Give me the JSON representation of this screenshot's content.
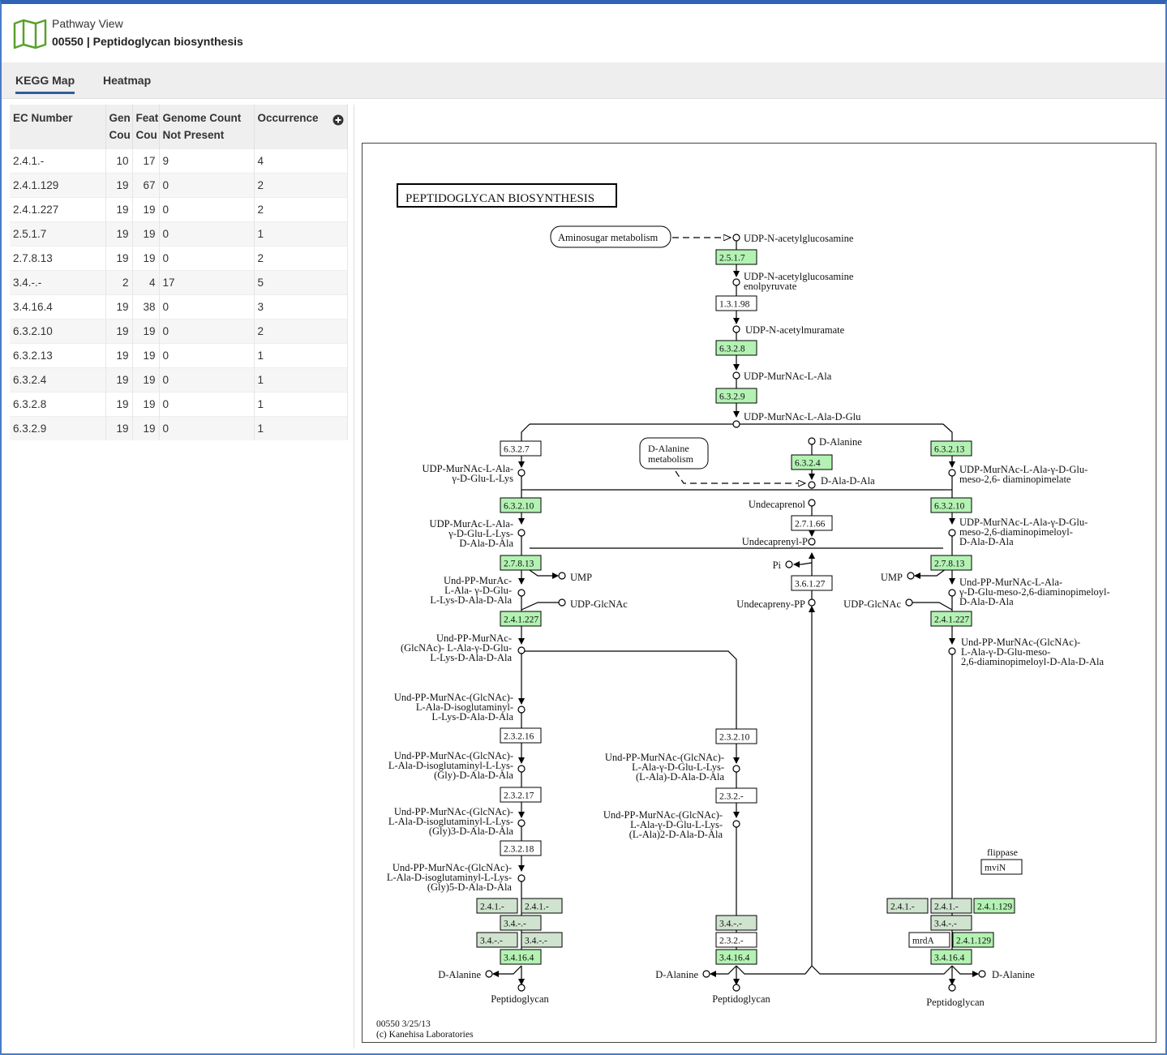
{
  "header": {
    "label": "Pathway View",
    "title": "00550 | Peptidoglycan biosynthesis"
  },
  "tabs": [
    {
      "label": "KEGG Map",
      "active": true
    },
    {
      "label": "Heatmap",
      "active": false
    }
  ],
  "table": {
    "columns": [
      "EC Number",
      "Genome Count",
      "Feature Count",
      "Genome Count Not Present",
      "Occurrence"
    ],
    "column_display": [
      "EC Number",
      "Gen Cou",
      "Feat Cou",
      "Genome Count Not Present",
      "Occurrence"
    ],
    "rows": [
      [
        "2.4.1.-",
        "10",
        "17",
        "9",
        "4"
      ],
      [
        "2.4.1.129",
        "19",
        "67",
        "0",
        "2"
      ],
      [
        "2.4.1.227",
        "19",
        "19",
        "0",
        "2"
      ],
      [
        "2.5.1.7",
        "19",
        "19",
        "0",
        "1"
      ],
      [
        "2.7.8.13",
        "19",
        "19",
        "0",
        "2"
      ],
      [
        "3.4.-.-",
        "2",
        "4",
        "17",
        "5"
      ],
      [
        "3.4.16.4",
        "19",
        "38",
        "0",
        "3"
      ],
      [
        "6.3.2.10",
        "19",
        "19",
        "0",
        "2"
      ],
      [
        "6.3.2.13",
        "19",
        "19",
        "0",
        "1"
      ],
      [
        "6.3.2.4",
        "19",
        "19",
        "0",
        "1"
      ],
      [
        "6.3.2.8",
        "19",
        "19",
        "0",
        "1"
      ],
      [
        "6.3.2.9",
        "19",
        "19",
        "0",
        "1"
      ]
    ]
  },
  "map": {
    "title": "PEPTIDOGLYCAN BIOSYNTHESIS",
    "footer_id": "00550 3/25/13",
    "footer_copyright": "(c) Kanehisa Laboratories",
    "colors": {
      "present": "#b3f2b3",
      "partial": "#cfe3cf",
      "absent": "#ffffff"
    },
    "links": {
      "aminosugar": "Aminosugar metabolism",
      "dalanine_meta": [
        "D-Alanine",
        "metabolism"
      ]
    },
    "compounds": {
      "c1": "UDP-N-acetylglucosamine",
      "c2a": "UDP-N-acetylglucosamine",
      "c2b": "enolpyruvate",
      "c3": "UDP-N-acetylmuramate",
      "c4": "UDP-MurNAc-L-Ala",
      "c5": "UDP-MurNAc-L-Ala-D-Glu",
      "dala": "D-Alanine",
      "dalada": "D-Ala-D-Ala",
      "left1": [
        "UDP-MurNAc-L-Ala-",
        "γ-D-Glu-L-Lys"
      ],
      "left2": [
        "UDP-MurAc-L-Ala-",
        "γ-D-Glu-L-Lys-",
        "D-Ala-D-Ala"
      ],
      "left3": [
        "Und-PP-MurAc-",
        "L-Ala- γ-D-Glu-",
        "L-Lys-D-Ala-D-Ala"
      ],
      "left4": [
        "Und-PP-MurNAc-",
        "(GlcNAc)- L-Ala-γ-D-Glu-",
        "L-Lys-D-Ala-D-Ala"
      ],
      "left5": [
        "Und-PP-MurNAc-(GlcNAc)-",
        "L-Ala-D-isoglutaminyl-",
        "L-Lys-D-Ala-D-Ala"
      ],
      "left6": [
        "Und-PP-MurNAc-(GlcNAc)-",
        "L-Ala-D-isoglutaminyl-L-Lys-",
        "(Gly)-D-Ala-D-Ala"
      ],
      "left7": [
        "Und-PP-MurNAc-(GlcNAc)-",
        "L-Ala-D-isoglutaminyl-L-Lys-",
        "(Gly)3-D-Ala-D-Ala"
      ],
      "left8": [
        "Und-PP-MurNAc-(GlcNAc)-",
        "L-Ala-D-isoglutaminyl-L-Lys-",
        "(Gly)5-D-Ala-D-Ala"
      ],
      "mid1": [
        "Und-PP-MurNAc-(GlcNAc)-",
        "L-Ala-γ-D-Glu-L-Lys-",
        "(L-Ala)-D-Ala-D-Ala"
      ],
      "mid2": [
        "Und-PP-MurNAc-(GlcNAc)-",
        "L-Ala-γ-D-Glu-L-Lys-",
        "(L-Ala)2-D-Ala-D-Ala"
      ],
      "right1": [
        "UDP-MurNAc-L-Ala-γ-D-Glu-",
        "meso-2,6- diaminopimelate"
      ],
      "right2": [
        "UDP-MurNAc-L-Ala-γ-D-Glu-",
        "meso-2,6-diaminopimeloyl-",
        "D-Ala-D-Ala"
      ],
      "right3": [
        "Und-PP-MurNAc-L-Ala-",
        "γ-D-Glu-meso-2,6-diaminopimeloyl-",
        "D-Ala-D-Ala"
      ],
      "right4": [
        "Und-PP-MurNAc-(GlcNAc)-",
        "L-Ala-γ-D-Glu-meso-",
        "2,6-diaminopimeloyl-D-Ala-D-Ala"
      ],
      "undecaprenol": "Undecaprenol",
      "undecaprenylp": "Undecaprenyl-P",
      "undecaprenypp": "Undecapreny-PP",
      "pi": "Pi",
      "ump": "UMP",
      "udpglcnac": "UDP-GlcNAc",
      "peptidoglycan": "Peptidoglycan",
      "flippase": "flippase"
    },
    "enzymes": {
      "e2517": "2.5.1.7",
      "e13198": "1.3.1.98",
      "e6328": "6.3.2.8",
      "e6329": "6.3.2.9",
      "e6327": "6.3.2.7",
      "e6324": "6.3.2.4",
      "e63213": "6.3.2.13",
      "e63210": "6.3.2.10",
      "e27166": "2.7.1.66",
      "e27813": "2.7.8.13",
      "e36127": "3.6.1.27",
      "e241227": "2.4.1.227",
      "e23216": "2.3.2.16",
      "e23217": "2.3.2.17",
      "e23218": "2.3.2.18",
      "e23210": "2.3.2.10",
      "e232": "2.3.2.-",
      "e241": "2.4.1.-",
      "e34": "3.4.-.-",
      "e34164": "3.4.16.4",
      "e241129": "2.4.1.129",
      "mrdA": "mrdA",
      "mviN": "mviN"
    }
  }
}
